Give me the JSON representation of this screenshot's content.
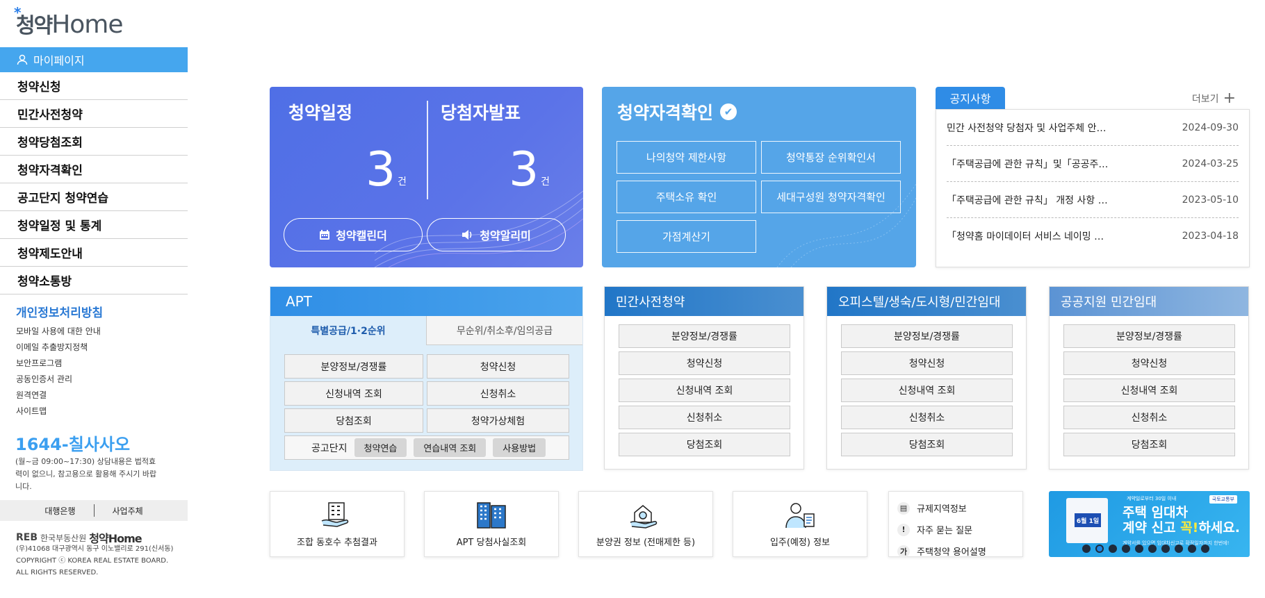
{
  "sidebar": {
    "logo_ko": "청약",
    "logo_en": "Home",
    "mypage": "마이페이지",
    "menu": [
      "청약신청",
      "민간사전청약",
      "청약당첨조회",
      "청약자격확인",
      "공고단지 청약연습",
      "청약일정 및 통계",
      "청약제도안내",
      "청약소통방"
    ],
    "privacy": "개인정보처리방침",
    "links": [
      "모바일 사용에 대한 안내",
      "이메일 추출방지정책",
      "보안프로그램",
      "공동인증서 관리",
      "원격연결",
      "사이트맵"
    ],
    "phone_num": "1644-",
    "phone_word": "칠사사오",
    "hours": "(월~금 09:00~17:30) 상담내용은 법적효력이 없으니, 참고용으로 활용해 주시기 바랍니다.",
    "bank": "대행은행",
    "business": "사업주체",
    "footer_logo_reb": "REB",
    "footer_logo_org": "한국부동산원",
    "footer_logo_home": "청약Home",
    "address": "(우)41068 대구광역시 동구 이노밸리로 291(신서동)",
    "copyright1": "COPYRIGHT ⓒ KOREA REAL ESTATE BOARD.",
    "copyright2": "ALL RIGHTS RESERVED."
  },
  "schedule": {
    "title": "청약일정",
    "count": "3",
    "unit": "건",
    "calendar_btn": "청약캘린더"
  },
  "winners": {
    "title": "당첨자발표",
    "count": "3",
    "unit": "건",
    "alarm_btn": "청약알리미"
  },
  "qualification": {
    "title": "청약자격확인",
    "buttons": [
      "나의청약 제한사항",
      "청약통장 순위확인서",
      "주택소유 확인",
      "세대구성원 청약자격확인",
      "가점계산기"
    ]
  },
  "notice": {
    "tab": "공지사항",
    "more": "더보기",
    "items": [
      {
        "title": "민간 사전청약 당첨자 및 사업주체 안…",
        "date": "2024-09-30"
      },
      {
        "title": "「주택공급에 관한 규칙」및「공공주…",
        "date": "2024-03-25"
      },
      {
        "title": "「주택공급에 관한 규칙」 개정 사항 …",
        "date": "2023-05-10"
      },
      {
        "title": "「청약홈 마이데이터 서비스 네이밍 …",
        "date": "2023-04-18"
      }
    ]
  },
  "apt": {
    "title": "APT",
    "tab_on": "특별공급/1·2순위",
    "tab_off": "무순위/취소후/임의공급",
    "buttons": [
      "분양정보/경쟁률",
      "청약신청",
      "신청내역 조회",
      "신청취소",
      "당첨조회",
      "청약가상체험"
    ],
    "practice_label": "공고단지",
    "chips": [
      "청약연습",
      "연습내역 조회",
      "사용방법"
    ]
  },
  "private_pre": {
    "title": "민간사전청약",
    "buttons": [
      "분양정보/경쟁률",
      "청약신청",
      "신청내역 조회",
      "신청취소",
      "당첨조회"
    ]
  },
  "officetel": {
    "title": "오피스텔/생숙/도시형/민간임대",
    "buttons": [
      "분양정보/경쟁률",
      "청약신청",
      "신청내역 조회",
      "신청취소",
      "당첨조회"
    ]
  },
  "public_rental": {
    "title": "공공지원 민간임대",
    "buttons": [
      "분양정보/경쟁률",
      "청약신청",
      "신청내역 조회",
      "신청취소",
      "당첨조회"
    ]
  },
  "bottom": {
    "cards": [
      "조합 동호수 추첨결과",
      "APT 당첨사실조회",
      "분양권 정보 (전매제한 등)",
      "입주(예정) 정보"
    ],
    "quick": [
      {
        "icon": "document-icon",
        "label": "규제지역정보"
      },
      {
        "icon": "exclamation-icon",
        "label": "자주 묻는 질문"
      },
      {
        "icon": "ga-icon",
        "label": "주택청약 용어설명"
      }
    ]
  },
  "banner": {
    "top": "계약일로부터 30일 이내",
    "line1_a": "주택 임대차",
    "line2_a": "계약 신고 ",
    "line2_b": "꼭!",
    "line2_c": "하세요.",
    "doc_date": "6월 1일",
    "small": "계약서를 있으면 임대차신고로 확정일자까지 한번에!",
    "logo": "국토교통부",
    "slides": 10,
    "active_slide": 2
  }
}
